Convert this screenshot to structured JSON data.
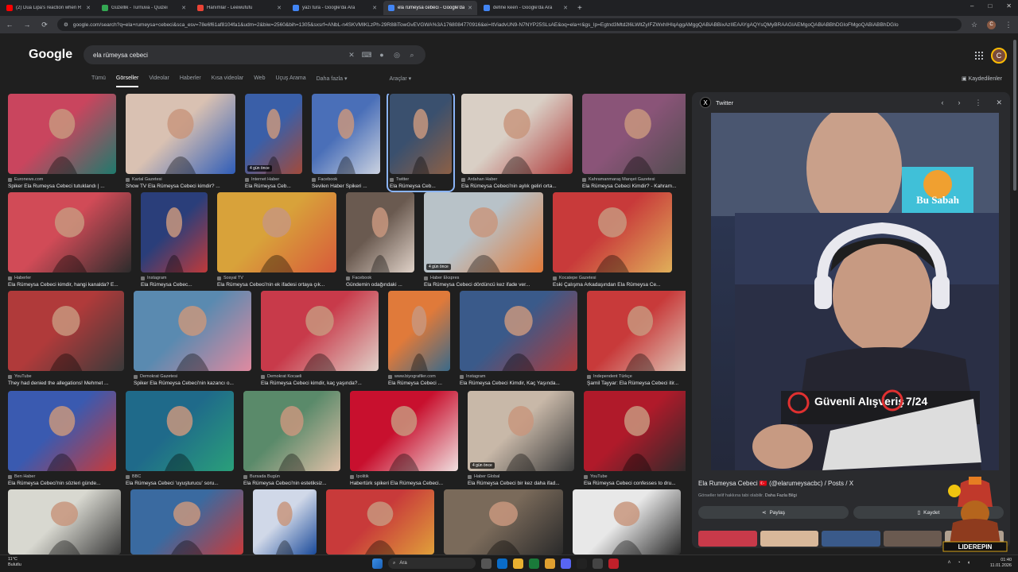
{
  "tabs": [
    {
      "title": "(2) Dua Lipa's reaction when R",
      "color": "#ff0000",
      "active": false
    },
    {
      "title": "Güzellik - Turnuva - Quizei",
      "color": "#34a853",
      "active": false
    },
    {
      "title": "Hanımlar - Leewufufu",
      "color": "#ea4335",
      "active": false
    },
    {
      "title": "yazı tura - Google'da Ara",
      "color": "#4285f4",
      "active": false
    },
    {
      "title": "ela rümeysa cebeci - Google'da",
      "color": "#4285f4",
      "active": true
    },
    {
      "title": "define keen - Google'da Ara",
      "color": "#4285f4",
      "active": false
    }
  ],
  "window": {
    "minimize": "–",
    "maximize": "□",
    "close": "✕",
    "newtab": "+"
  },
  "address": {
    "url": "google.com/search?q=ela+rumeysa+cebeci&sca_esv=78e6f61af8104fa1&udm=2&biw=2560&bih=1305&sxsrf=ANbL-n4SKVMIKLzPh-29R88iTowGvEVGWA%3A1768084770916&ei=ItViadvUN9-N7NYP25SLsAE&oq=ela+r&gs_lp=Egtnd3Mtd2l6LWltZyIFZWxhIHIqAggAMggQABiABBixAzIIEAAYgAQYsQMyBRAAGIAEMgoQABiABBhDGIoFMgoQABiABBhDGIo"
  },
  "google": {
    "logo": "Google",
    "query": "ela rümeysa cebeci",
    "avatar_letter": "C",
    "filters": [
      "Tümü",
      "Görseller",
      "Videolar",
      "Haberler",
      "Kısa videolar",
      "Web",
      "Uçuş Arama",
      "Daha fazla ▾",
      "Araçlar ▾"
    ],
    "active_filter": "Görseller",
    "saved": "Kaydedilenler"
  },
  "results": [
    [
      {
        "source": "Euronews.com",
        "caption": "Spiker Ela Rumeysa Cebeci tutuklandı | ...",
        "badge": "",
        "colors": [
          "#c9455e",
          "#1f7a6d"
        ]
      },
      {
        "source": "Kartal Gazetesi",
        "caption": "Show TV Ela Rümeysa Cebeci kimdir? ...",
        "badge": "",
        "colors": [
          "#d9c1b2",
          "#2f5db8"
        ]
      },
      {
        "source": "Internet Haber",
        "caption": "Ela Rümeysa Ceb...",
        "badge": "4 gün önce",
        "colors": [
          "#3a5fa8",
          "#a24a3a"
        ]
      },
      {
        "source": "Facebook",
        "caption": "Sevilen Haber Spikeri ...",
        "badge": "",
        "colors": [
          "#4a6fb8",
          "#cbd2e0"
        ]
      },
      {
        "source": "Twitter",
        "caption": "Ela Rümeysa Ceb...",
        "badge": "",
        "colors": [
          "#3a506e",
          "#8c6046"
        ]
      },
      {
        "source": "Ardahan Haber",
        "caption": "Ela Rümeysa Cebeci'nin aylık geliri orta...",
        "badge": "",
        "colors": [
          "#d9cfc5",
          "#b03a3a"
        ]
      },
      {
        "source": "Kahramanmaraş Manşet Gazetesi",
        "caption": "Ela Rümeysa Cebeci Kimdir? - Kahram...",
        "badge": "",
        "colors": [
          "#8a5478",
          "#4c4c4c"
        ]
      }
    ],
    [
      {
        "source": "Haberler",
        "caption": "Ela Rümeysa Cebeci kimdir, hangi kanalda? E...",
        "badge": "",
        "colors": [
          "#d14b57",
          "#2c2c2c"
        ]
      },
      {
        "source": "Instagram",
        "caption": "Ela Rümeysa Cebec...",
        "badge": "",
        "colors": [
          "#2a3e7a",
          "#c03a3a"
        ]
      },
      {
        "source": "Sosyal TV",
        "caption": "Ela Rümeysa Cebeci'nin ek ifadesi ortaya çık...",
        "badge": "",
        "colors": [
          "#d8a23a",
          "#d85a3a"
        ]
      },
      {
        "source": "Facebook",
        "caption": "Gündemin odağındaki ...",
        "badge": "",
        "colors": [
          "#6a5a50",
          "#e0d2c8"
        ]
      },
      {
        "source": "Haber Ekspres",
        "caption": "Ela Rümeysa Cebeci dördüncü kez ifade ver...",
        "badge": "4 gün önce",
        "colors": [
          "#b8c2c8",
          "#e07a3a"
        ]
      },
      {
        "source": "Kocatepe Gazetesi",
        "caption": "Eski Çalışma Arkadaşından Ela Rümeysa Ce...",
        "badge": "",
        "colors": [
          "#c83a3a",
          "#e0b05a"
        ]
      }
    ],
    [
      {
        "source": "YouTube",
        "caption": "They had denied the allegations! Mehmet ...",
        "badge": "",
        "colors": [
          "#b03a3a",
          "#3a3a3a"
        ]
      },
      {
        "source": "Demokrat Gazetesi",
        "caption": "Spiker Ela Rümeysa Cebeci'nin kazancı o...",
        "badge": "",
        "colors": [
          "#5a8ab0",
          "#e08aa0"
        ]
      },
      {
        "source": "Demokrat Kocaeli",
        "caption": "Ela Rümeysa Cebeci kimdir, kaç yaşında?...",
        "badge": "",
        "colors": [
          "#c83a4a",
          "#e0d0c8"
        ]
      },
      {
        "source": "www.biyografiler.com",
        "caption": "Ela Rümeysa Cebeci ...",
        "badge": "",
        "colors": [
          "#e07a3a",
          "#3a6a8a"
        ]
      },
      {
        "source": "Instagram",
        "caption": "Ela Rümeysa Cebeci Kimdir, Kaç Yaşında...",
        "badge": "",
        "colors": [
          "#3a5a8a",
          "#b03a3a"
        ]
      },
      {
        "source": "Independent Türkçe",
        "caption": "Şamil Tayyar: Ela Rümeysa Cebeci itir...",
        "badge": "",
        "colors": [
          "#c83a3a",
          "#e0d0c0"
        ]
      }
    ],
    [
      {
        "source": "Ben Haber",
        "caption": "Ela Rümeysa Cebeci'nin sözleri günde...",
        "badge": "",
        "colors": [
          "#3a5ab0",
          "#c83a3a"
        ]
      },
      {
        "source": "BBC",
        "caption": "Ela Rümeysa Cebeci 'uyuşturucu' soru...",
        "badge": "",
        "colors": [
          "#1f6a8a",
          "#2aa07a"
        ]
      },
      {
        "source": "Bursada Bugün",
        "caption": "Ela Rümeysa Cebeci'nin estetiksiz...",
        "badge": "",
        "colors": [
          "#5a8a6a",
          "#e0c0a8"
        ]
      },
      {
        "source": "İpolitik",
        "caption": "Habertürk spikeri Ela Rümeysa Cebeci...",
        "badge": "",
        "colors": [
          "#c8102e",
          "#f0e0e0"
        ]
      },
      {
        "source": "Haber Global",
        "caption": "Ela Rümeysa Cebeci bir kez daha ifad...",
        "badge": "4 gün önce",
        "colors": [
          "#c8b8a8",
          "#3a3a3a"
        ]
      },
      {
        "source": "YouTube",
        "caption": "Ela Rümeysa Cebeci confesses to dru...",
        "badge": "",
        "colors": [
          "#b01a2a",
          "#2a2a2a"
        ]
      }
    ],
    [
      {
        "source": "",
        "caption": "",
        "badge": "",
        "colors": [
          "#d8d8d0",
          "#3a3a3a"
        ]
      },
      {
        "source": "",
        "caption": "",
        "badge": "",
        "colors": [
          "#3a6aa0",
          "#c83a3a"
        ]
      },
      {
        "source": "",
        "caption": "",
        "badge": "",
        "colors": [
          "#d0d8e8",
          "#1a4a9a"
        ]
      },
      {
        "source": "",
        "caption": "",
        "badge": "",
        "colors": [
          "#c83a3a",
          "#e0a03a"
        ]
      },
      {
        "source": "",
        "caption": "",
        "badge": "",
        "colors": [
          "#7a6a5a",
          "#2a2a2a"
        ]
      },
      {
        "source": "",
        "caption": "",
        "badge": "",
        "colors": [
          "#e8e8e8",
          "#2a2a2a"
        ]
      }
    ]
  ],
  "panel": {
    "site": "Twitter",
    "title": "Ela Rumeysa Cebeci 🇹🇷 (@elarumeysacbc) / Posts / X",
    "subtitle": "Görseller telif hakkına tabi olabilir.",
    "more_info": "Daha Fazla Bilgi",
    "share": "Paylaş",
    "save": "Kaydet",
    "overlay_banner": "Bu Sabah",
    "overlay_left": "Güvenli Alışveriş",
    "overlay_right": "7/24",
    "mascot": "LIDEREPIN"
  },
  "taskbar": {
    "weather_temp": "11°C",
    "weather_desc": "Bulutlu",
    "search": "Ara",
    "time": "01:40",
    "date": "11.01.2026"
  }
}
